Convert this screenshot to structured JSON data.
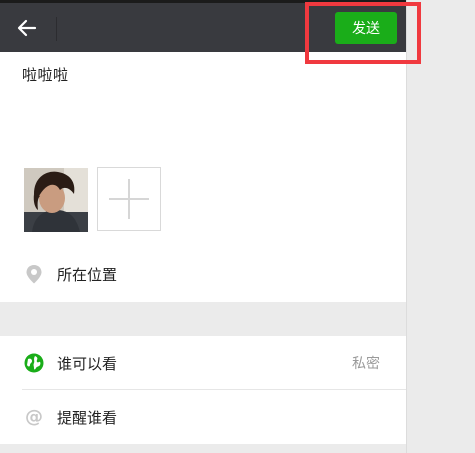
{
  "header": {
    "back_icon": "arrow-left-icon",
    "send_label": "发送",
    "send_color": "#1aad19"
  },
  "post": {
    "text": "啦啦啦"
  },
  "location": {
    "icon": "location-pin-icon",
    "label": "所在位置"
  },
  "visibility": {
    "icon": "globe-icon",
    "label": "谁可以看",
    "value": "私密"
  },
  "mention": {
    "icon": "at-icon",
    "label": "提醒谁看"
  },
  "highlight_color": "#f0393f"
}
